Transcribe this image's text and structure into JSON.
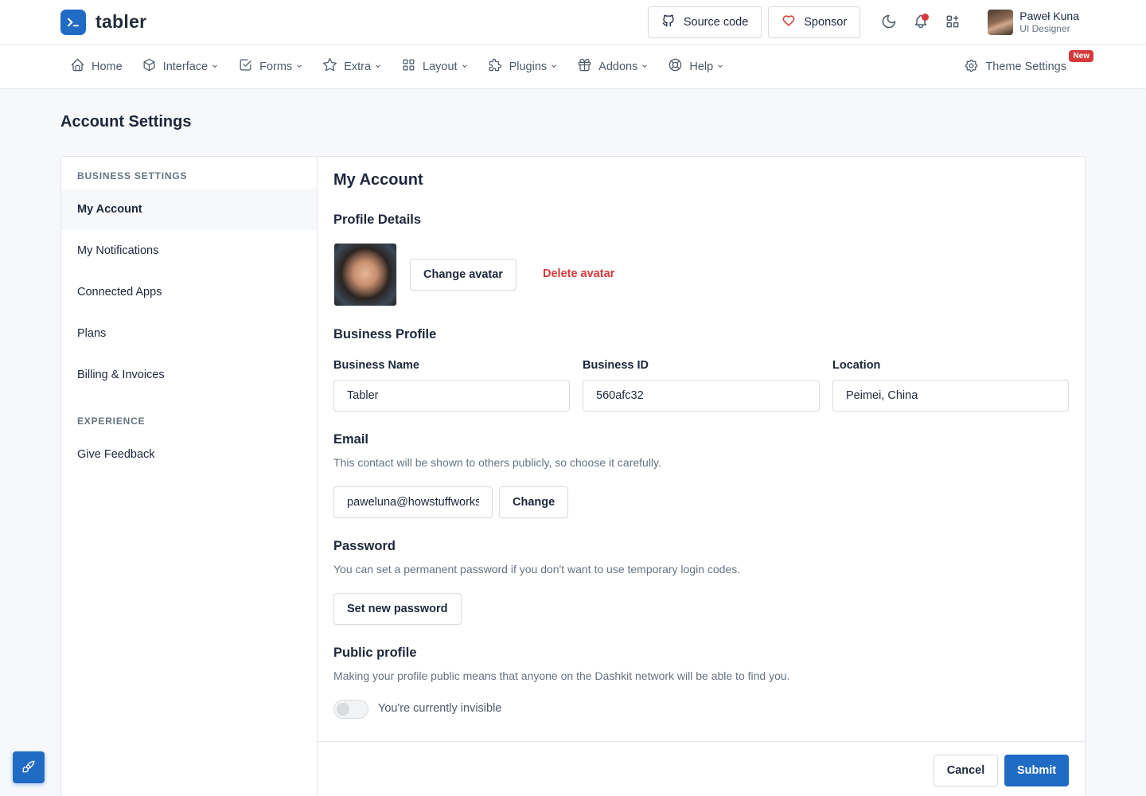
{
  "brand": {
    "name": "tabler"
  },
  "header": {
    "source_code_label": "Source code",
    "sponsor_label": "Sponsor",
    "user": {
      "name": "Paweł Kuna",
      "role": "UI Designer"
    }
  },
  "nav": {
    "items": [
      {
        "label": "Home",
        "icon": "home-icon"
      },
      {
        "label": "Interface",
        "icon": "package-icon"
      },
      {
        "label": "Forms",
        "icon": "checkbox-icon"
      },
      {
        "label": "Extra",
        "icon": "star-icon"
      },
      {
        "label": "Layout",
        "icon": "layout-grid-icon"
      },
      {
        "label": "Plugins",
        "icon": "puzzle-icon"
      },
      {
        "label": "Addons",
        "icon": "gift-icon"
      },
      {
        "label": "Help",
        "icon": "lifebuoy-icon"
      }
    ],
    "theme_settings_label": "Theme Settings",
    "new_badge": "New"
  },
  "page": {
    "title": "Account Settings"
  },
  "sidebar": {
    "section1": "BUSINESS SETTINGS",
    "items": [
      "My Account",
      "My Notifications",
      "Connected Apps",
      "Plans",
      "Billing & Invoices"
    ],
    "section2": "EXPERIENCE",
    "items2": [
      "Give Feedback"
    ]
  },
  "main": {
    "title": "My Account",
    "profile_details": "Profile Details",
    "change_avatar": "Change avatar",
    "delete_avatar": "Delete avatar",
    "business_profile": "Business Profile",
    "fields": {
      "business_name": {
        "label": "Business Name",
        "value": "Tabler"
      },
      "business_id": {
        "label": "Business ID",
        "value": "560afc32"
      },
      "location": {
        "label": "Location",
        "value": "Peimei, China"
      }
    },
    "email": {
      "title": "Email",
      "desc": "This contact will be shown to others publicly, so choose it carefully.",
      "value": "paweluna@howstuffworks.com",
      "change_label": "Change"
    },
    "password": {
      "title": "Password",
      "desc": "You can set a permanent password if you don't want to use temporary login codes.",
      "button": "Set new password"
    },
    "public_profile": {
      "title": "Public profile",
      "desc": "Making your profile public means that anyone on the Dashkit network will be able to find you.",
      "toggle_label": "You're currently invisible",
      "enabled": false
    },
    "footer": {
      "cancel": "Cancel",
      "submit": "Submit"
    }
  },
  "colors": {
    "primary": "#206bc4",
    "danger": "#d63939",
    "background": "#f6f8fb"
  }
}
